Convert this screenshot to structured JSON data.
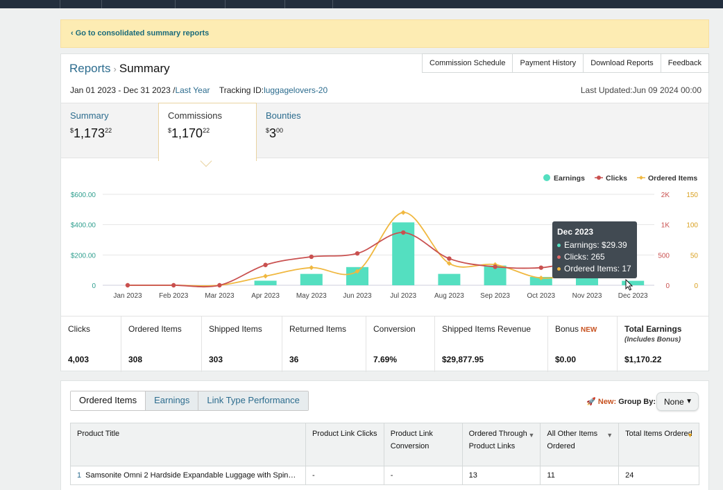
{
  "banner": {
    "link": "‹ Go to consolidated summary reports"
  },
  "header": {
    "breadcrumb_root": "Reports",
    "breadcrumb_current": "Summary",
    "tabs": [
      "Commission Schedule",
      "Payment History",
      "Download Reports",
      "Feedback"
    ],
    "date_range": "Jan 01 2023 - Dec 31 2023 /",
    "range_link": "Last Year",
    "tracking_label": "Tracking ID:",
    "tracking_id": "luggagelovers-20",
    "last_updated": "Last Updated:Jun 09 2024 00:00"
  },
  "summary_tabs": [
    {
      "label": "Summary",
      "dollar": "$",
      "whole": "1,173",
      "cents": "22"
    },
    {
      "label": "Commissions",
      "dollar": "$",
      "whole": "1,170",
      "cents": "22"
    },
    {
      "label": "Bounties",
      "dollar": "$",
      "whole": "3",
      "cents": "00"
    }
  ],
  "chart_data": {
    "type": "bar+line",
    "categories": [
      "Jan 2023",
      "Feb 2023",
      "Mar 2023",
      "Apr 2023",
      "May 2023",
      "Jun 2023",
      "Jul 2023",
      "Aug 2023",
      "Sep 2023",
      "Oct 2023",
      "Nov 2023",
      "Dec 2023"
    ],
    "series": [
      {
        "name": "Earnings",
        "type": "bar",
        "axis": "left",
        "color": "#54dfc0",
        "values": [
          0,
          0,
          0,
          30,
          75,
          120,
          415,
          75,
          130,
          55,
          90,
          29.39
        ]
      },
      {
        "name": "Clicks",
        "type": "line",
        "axis": "right1",
        "color": "#c9504f",
        "values": [
          0,
          0,
          0,
          335,
          470,
          525,
          870,
          440,
          305,
          290,
          400,
          265
        ]
      },
      {
        "name": "Ordered Items",
        "type": "line",
        "axis": "right2",
        "color": "#f0b840",
        "values": [
          0,
          0,
          0,
          15,
          29,
          23,
          120,
          36,
          34,
          12,
          21,
          17
        ]
      }
    ],
    "left_axis": {
      "ticks": [
        "0",
        "$200.00",
        "$400.00",
        "$600.00"
      ],
      "ylim": [
        0,
        600
      ]
    },
    "right_axis_1": {
      "ticks": [
        "0",
        "500",
        "1K",
        "2K"
      ]
    },
    "right_axis_2": {
      "ticks": [
        "0",
        "50",
        "100",
        "150"
      ],
      "ylim": [
        0,
        150
      ]
    },
    "legend": [
      "Earnings",
      "Clicks",
      "Ordered Items"
    ],
    "legend_position": "top-right",
    "grid": true,
    "tooltip": {
      "title": "Dec 2023",
      "lines": [
        "Earnings: $29.39",
        "Clicks: 265",
        "Ordered Items: 17"
      ]
    }
  },
  "metrics": [
    {
      "label": "Clicks",
      "value": "4,003"
    },
    {
      "label": "Ordered Items",
      "value": "308"
    },
    {
      "label": "Shipped Items",
      "value": "303"
    },
    {
      "label": "Returned Items",
      "value": "36"
    },
    {
      "label": "Conversion",
      "value": "7.69%"
    },
    {
      "label": "Shipped Items Revenue",
      "value": "$29,877.95"
    },
    {
      "label": "Bonus",
      "badge": "NEW",
      "value": "$0.00"
    },
    {
      "label": "Total Earnings",
      "sub": "(Includes Bonus)",
      "value": "$1,170.22"
    }
  ],
  "bottom": {
    "tabs": [
      "Ordered Items",
      "Earnings",
      "Link Type Performance"
    ],
    "new_label": "New:",
    "groupby_label": "Group By:",
    "groupby_value": "None",
    "columns": [
      "Product Title",
      "Product Link Clicks",
      "Product Link Conversion",
      "Ordered Through Product Links",
      "All Other Items Ordered",
      "Total Items Ordered"
    ],
    "rows": [
      {
        "num": "1",
        "title": "Samsonite Omni 2 Hardside Expandable Luggage with Spin…",
        "clicks": "-",
        "conversion": "-",
        "ordered_through": "13",
        "other": "11",
        "total": "24"
      }
    ]
  }
}
